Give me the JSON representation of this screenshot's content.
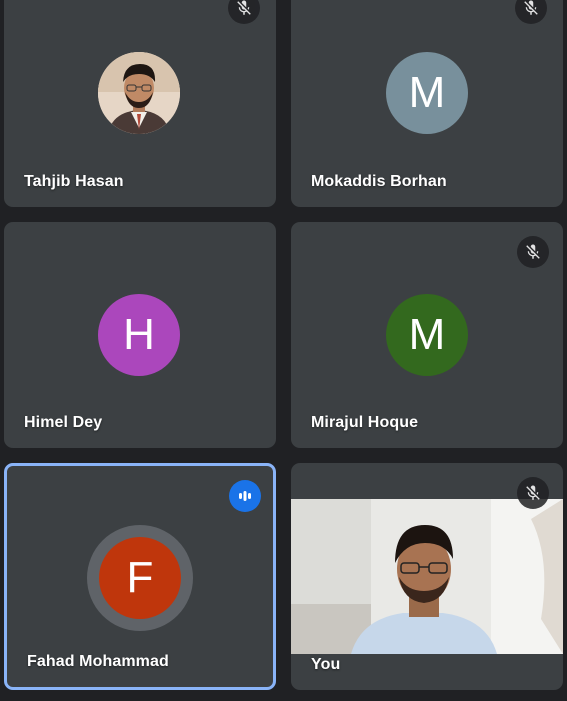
{
  "participants": [
    {
      "name": "Tahjib Hasan",
      "avatar": "photo",
      "muted": true
    },
    {
      "name": "Mokaddis Borhan",
      "initial": "M",
      "avatar_color": "#78909c",
      "muted": true
    },
    {
      "name": "Himel Dey",
      "initial": "H",
      "avatar_color": "#ab47bc",
      "muted": false
    },
    {
      "name": "Mirajul Hoque",
      "initial": "M",
      "avatar_color": "#33691e",
      "muted": true
    },
    {
      "name": "Fahad Mohammad",
      "initial": "F",
      "avatar_color": "#bf360c",
      "muted": false,
      "speaking": true
    },
    {
      "name": "You",
      "avatar": "video",
      "muted": true
    }
  ],
  "colors": {
    "background": "#202124",
    "tile": "#3c4043",
    "speaking_border": "#8ab4f8",
    "speaking_indicator": "#1a73e8"
  }
}
